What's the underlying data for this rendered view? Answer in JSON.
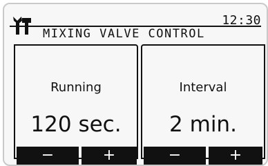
{
  "status": {
    "time": "12:30"
  },
  "header": {
    "title": "MIXING VALVE CONTROL",
    "icon": "wrench-screwdriver-icon"
  },
  "panels": [
    {
      "label": "Running",
      "value": "120 sec."
    },
    {
      "label": "Interval",
      "value": "2 min."
    }
  ],
  "buttons": {
    "decrease": "−",
    "increase": "+"
  }
}
